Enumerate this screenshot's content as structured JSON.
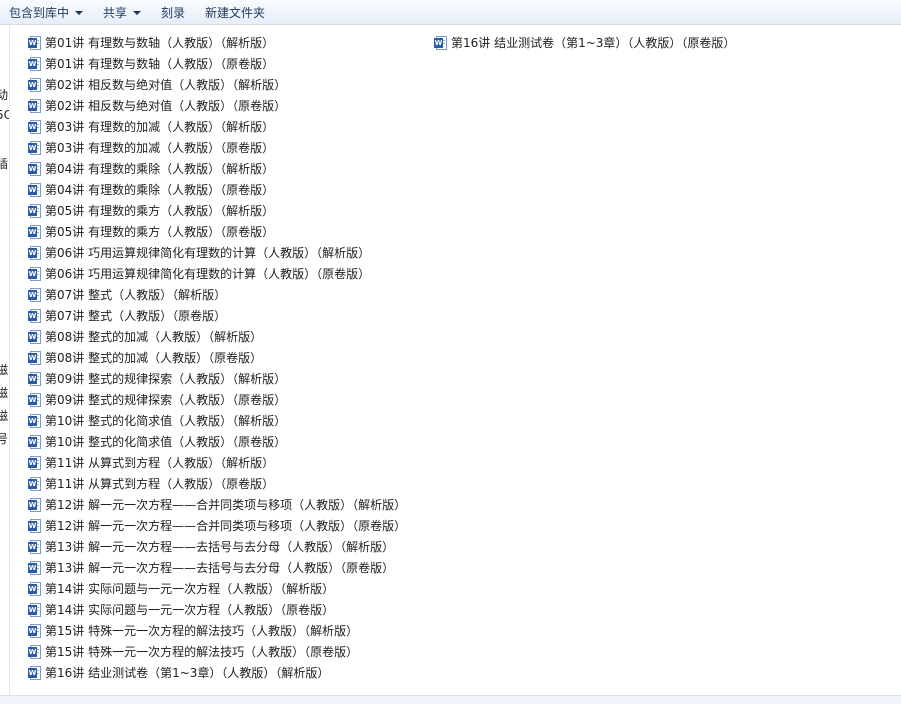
{
  "toolbar": {
    "include_library": "包含到库中",
    "share": "共享",
    "burn": "刻录",
    "new_folder": "新建文件夹"
  },
  "nav_fragments": [
    "动",
    "5C",
    "插",
    "磁",
    "磁",
    "磁",
    "号"
  ],
  "icon": {
    "name": "word-document-icon",
    "letter": "W",
    "color": "#2a5caa"
  },
  "files": {
    "col1": [
      "第01讲 有理数与数轴（人教版）（解析版）",
      "第01讲 有理数与数轴（人教版）（原卷版）",
      "第02讲 相反数与绝对值（人教版）（解析版）",
      "第02讲 相反数与绝对值（人教版）（原卷版）",
      "第03讲 有理数的加减（人教版）（解析版）",
      "第03讲 有理数的加减（人教版）（原卷版）",
      "第04讲 有理数的乘除（人教版）（解析版）",
      "第04讲 有理数的乘除（人教版）（原卷版）",
      "第05讲 有理数的乘方（人教版）（解析版）",
      "第05讲 有理数的乘方（人教版）（原卷版）",
      "第06讲 巧用运算规律简化有理数的计算（人教版）（解析版）",
      "第06讲 巧用运算规律简化有理数的计算（人教版）（原卷版）",
      "第07讲 整式（人教版）（解析版）",
      "第07讲 整式（人教版）（原卷版）",
      "第08讲 整式的加减（人教版）（解析版）",
      "第08讲 整式的加减（人教版）（原卷版）",
      "第09讲 整式的规律探索（人教版）（解析版）",
      "第09讲 整式的规律探索（人教版）（原卷版）",
      "第10讲 整式的化简求值（人教版）（解析版）",
      "第10讲 整式的化简求值（人教版）（原卷版）",
      "第11讲 从算式到方程（人教版）（解析版）",
      "第11讲 从算式到方程（人教版）（原卷版）",
      "第12讲 解一元一次方程——合并同类项与移项（人教版）（解析版）",
      "第12讲 解一元一次方程——合并同类项与移项（人教版）（原卷版）",
      "第13讲 解一元一次方程——去括号与去分母（人教版）（解析版）",
      "第13讲 解一元一次方程——去括号与去分母（人教版）（原卷版）",
      "第14讲 实际问题与一元一次方程（人教版）（解析版）",
      "第14讲 实际问题与一元一次方程（人教版）（原卷版）",
      "第15讲 特殊一元一次方程的解法技巧（人教版）（解析版）",
      "第15讲 特殊一元一次方程的解法技巧（人教版）（原卷版）",
      "第16讲 结业测试卷（第1~3章）（人教版）（解析版）"
    ],
    "col2": [
      "第16讲 结业测试卷（第1~3章）（人教版）（原卷版）"
    ]
  }
}
